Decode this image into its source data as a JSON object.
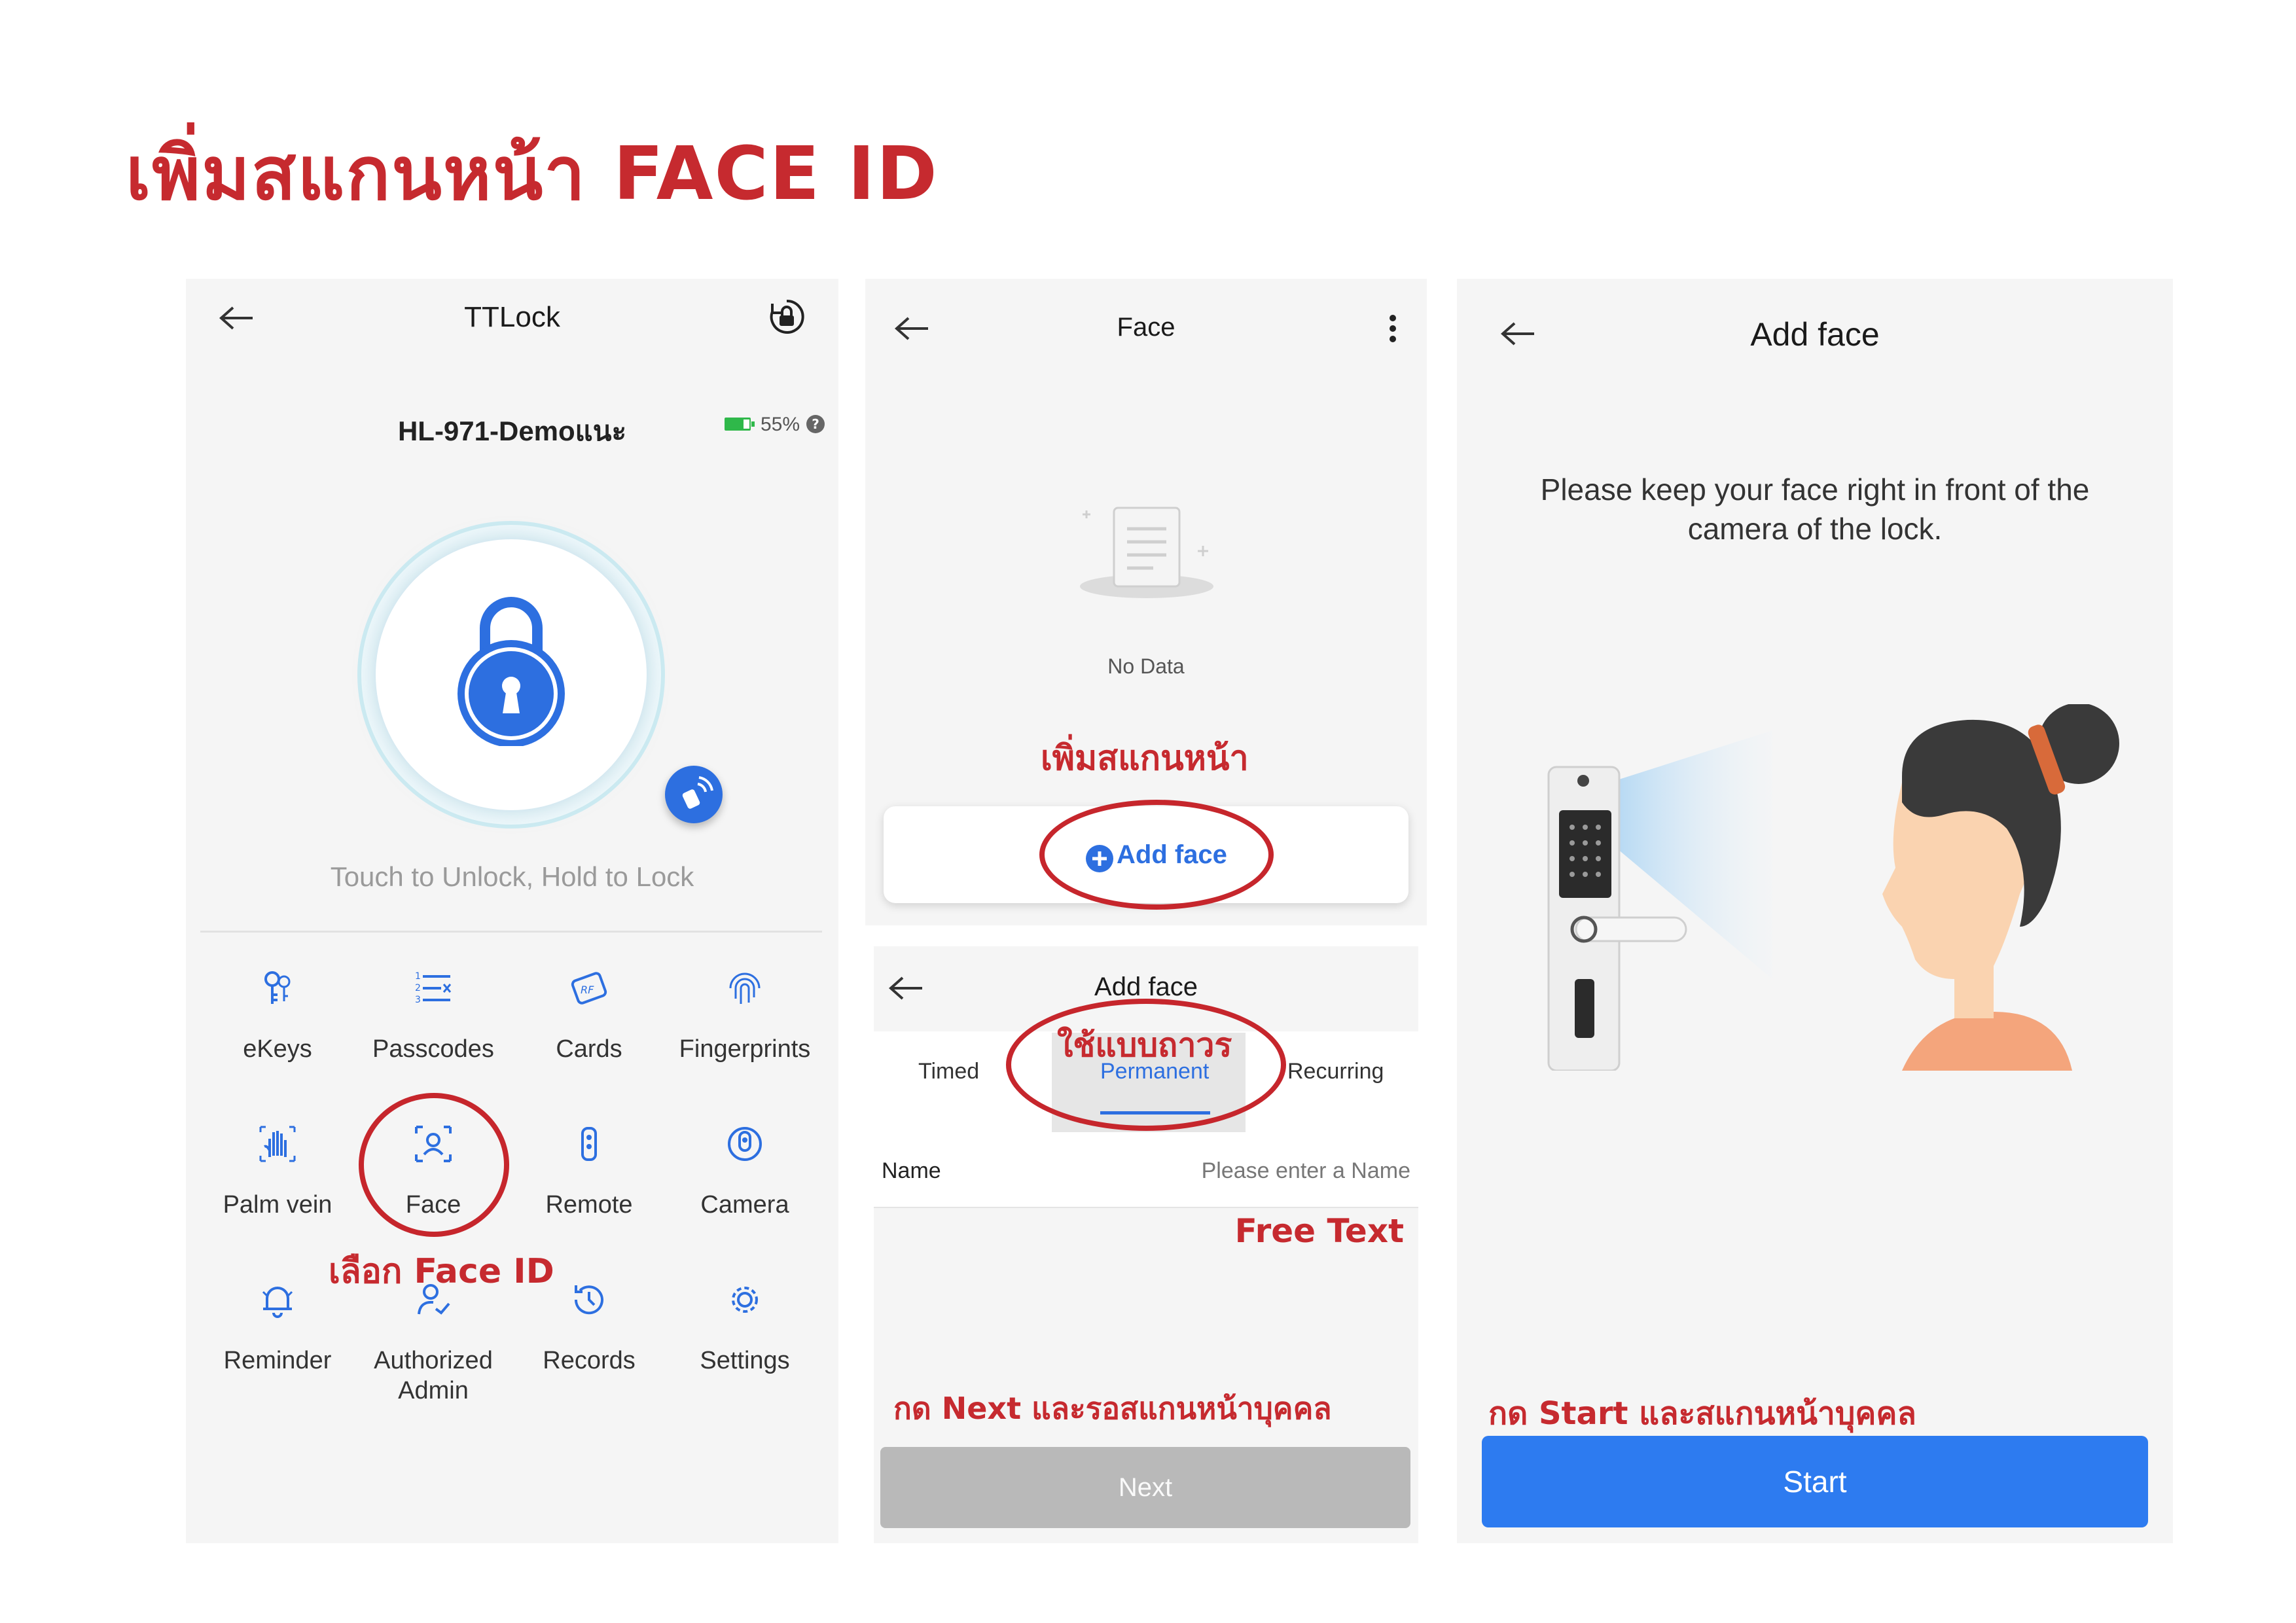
{
  "page": {
    "title": "เพิ่มสแกนหน้า FACE ID"
  },
  "panel1": {
    "header_title": "TTLock",
    "lock_name": "HL-971-Demoแนะ",
    "battery": "55%",
    "hint": "Touch to Unlock, Hold to Lock",
    "grid": [
      {
        "label": "eKeys",
        "icon": "key-icon"
      },
      {
        "label": "Passcodes",
        "icon": "passcode-list-icon"
      },
      {
        "label": "Cards",
        "icon": "rf-card-icon"
      },
      {
        "label": "Fingerprints",
        "icon": "fingerprint-icon"
      },
      {
        "label": "Palm vein",
        "icon": "palm-icon"
      },
      {
        "label": "Face",
        "icon": "face-scan-icon"
      },
      {
        "label": "Remote",
        "icon": "remote-icon"
      },
      {
        "label": "Camera",
        "icon": "camera-icon"
      },
      {
        "label": "Reminder",
        "icon": "bell-icon"
      },
      {
        "label": "Authorized Admin",
        "icon": "admin-icon"
      },
      {
        "label": "Records",
        "icon": "history-icon"
      },
      {
        "label": "Settings",
        "icon": "gear-icon"
      }
    ],
    "annotation": "เลือก Face ID",
    "colors": {
      "accent": "#2d6fe0",
      "annotation": "#c62a2f"
    }
  },
  "panel2a": {
    "header_title": "Face",
    "empty_text": "No Data",
    "annotation": "เพิ่มสแกนหน้า",
    "add_label": "Add face"
  },
  "panel2b": {
    "header_title": "Add face",
    "annotation_tab": "ใช้แบบถาวร",
    "tabs": [
      "Timed",
      "Permanent",
      "Recurring"
    ],
    "name_label": "Name",
    "name_placeholder": "Please enter a Name",
    "annotation_name": "Free Text",
    "annotation_next": "กด Next และรอสแกนหน้าบุคคล",
    "next_label": "Next"
  },
  "panel3": {
    "header_title": "Add face",
    "instruction": "Please keep your face right in front of the camera of the lock.",
    "annotation": "กด Start และสแกนหน้าบุคคล",
    "start_label": "Start",
    "colors": {
      "button": "#2d7bf0"
    }
  }
}
